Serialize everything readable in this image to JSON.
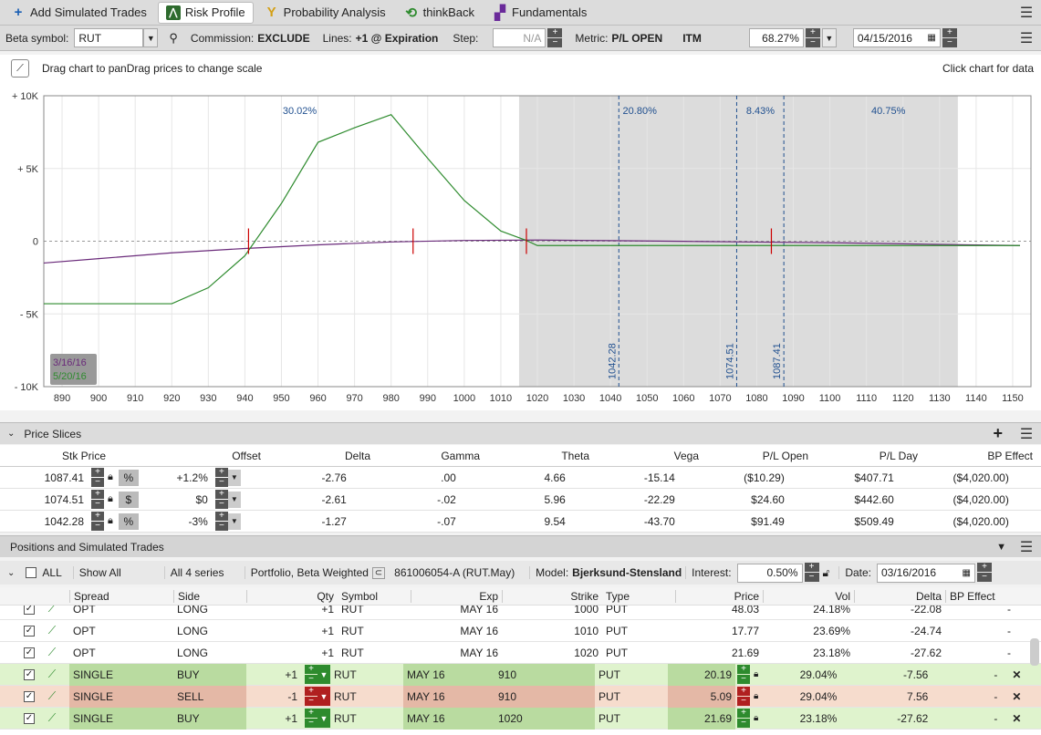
{
  "tabs": [
    {
      "label": "Add Simulated Trades",
      "icon": "plus-icon"
    },
    {
      "label": "Risk Profile",
      "icon": "risk-profile-icon"
    },
    {
      "label": "Probability Analysis",
      "icon": "probability-icon"
    },
    {
      "label": "thinkBack",
      "icon": "thinkback-icon"
    },
    {
      "label": "Fundamentals",
      "icon": "fundamentals-icon"
    }
  ],
  "toolbar": {
    "beta_label": "Beta symbol:",
    "beta_value": "RUT",
    "commission_label": "Commission:",
    "commission_value": "EXCLUDE",
    "lines_label": "Lines:",
    "lines_value": "+1 @ Expiration",
    "step_label": "Step:",
    "step_value": "N/A",
    "metric_label": "Metric:",
    "metric_value": "P/L OPEN",
    "itm": "ITM",
    "pct_value": "68.27%",
    "date_value": "04/15/2016"
  },
  "chart_header": {
    "hint": "Drag chart to panDrag prices to change scale",
    "click_hint": "Click chart for data"
  },
  "chart_data": {
    "type": "line",
    "x_ticks": [
      890,
      900,
      910,
      920,
      930,
      940,
      950,
      960,
      970,
      980,
      990,
      1000,
      1010,
      1020,
      1030,
      1040,
      1050,
      1060,
      1070,
      1080,
      1090,
      1100,
      1110,
      1120,
      1130,
      1140,
      1150
    ],
    "y_ticks": [
      "+ 10K",
      "+ 5K",
      "0",
      "- 5K",
      "- 10K"
    ],
    "y_tick_values": [
      10000,
      5000,
      0,
      -5000,
      -10000
    ],
    "xlim": [
      885,
      1155
    ],
    "ylim": [
      -10000,
      10000
    ],
    "prob_labels": [
      "30.02%",
      "20.80%",
      "8.43%",
      "40.75%"
    ],
    "prob_label_x": [
      955,
      1048,
      1081,
      1116
    ],
    "shaded_range": [
      1015,
      1135
    ],
    "vlines": [
      {
        "x": 1042.28,
        "label": "1042.28"
      },
      {
        "x": 1074.51,
        "label": "1074.51"
      },
      {
        "x": 1087.41,
        "label": "1087.41"
      }
    ],
    "markers": [
      941,
      986,
      1017,
      1084
    ],
    "legend": [
      "3/16/16",
      "5/20/16"
    ],
    "series": [
      {
        "name": "3/16/16",
        "color": "#6a2a7a",
        "x": [
          885,
          900,
          920,
          940,
          960,
          980,
          1000,
          1020,
          1040,
          1060,
          1080,
          1100,
          1120,
          1140,
          1152
        ],
        "y": [
          -1500,
          -1200,
          -800,
          -500,
          -250,
          -50,
          50,
          80,
          40,
          -10,
          -60,
          -100,
          -180,
          -260,
          -300
        ]
      },
      {
        "name": "5/20/16",
        "color": "#2e8b2e",
        "x": [
          885,
          920,
          930,
          940,
          950,
          960,
          970,
          980,
          990,
          1000,
          1010,
          1017,
          1020,
          1050,
          1100,
          1152
        ],
        "y": [
          -4300,
          -4300,
          -3200,
          -1000,
          2600,
          6800,
          7800,
          8700,
          5700,
          2800,
          700,
          50,
          -300,
          -300,
          -300,
          -300
        ]
      }
    ]
  },
  "price_slices": {
    "title": "Price Slices",
    "headers": [
      "Stk Price",
      "Offset",
      "Delta",
      "Gamma",
      "Theta",
      "Vega",
      "P/L Open",
      "P/L Day",
      "BP Effect"
    ],
    "rows": [
      {
        "price": "1087.41",
        "unit": "%",
        "offset": "+1.2%",
        "delta": "-2.76",
        "gamma": ".00",
        "theta": "4.66",
        "vega": "-15.14",
        "pl_open": "($10.29)",
        "pl_day": "$407.71",
        "bp": "($4,020.00)"
      },
      {
        "price": "1074.51",
        "unit": "$",
        "offset": "$0",
        "delta": "-2.61",
        "gamma": "-.02",
        "theta": "5.96",
        "vega": "-22.29",
        "pl_open": "$24.60",
        "pl_day": "$442.60",
        "bp": "($4,020.00)"
      },
      {
        "price": "1042.28",
        "unit": "%",
        "offset": "-3%",
        "delta": "-1.27",
        "gamma": "-.07",
        "theta": "9.54",
        "vega": "-43.70",
        "pl_open": "$91.49",
        "pl_day": "$509.49",
        "bp": "($4,020.00)"
      }
    ]
  },
  "positions": {
    "title": "Positions and Simulated Trades",
    "all": "ALL",
    "show": "Show All",
    "series": "All 4 series",
    "portfolio": "Portfolio, Beta Weighted",
    "account": "861006054-A (RUT.May)",
    "model_label": "Model:",
    "model": "Bjerksund-Stensland",
    "interest_label": "Interest:",
    "interest": "0.50%",
    "date_label": "Date:",
    "date": "03/16/2016",
    "headers": [
      "Spread",
      "Side",
      "Qty",
      "Symbol",
      "Exp",
      "Strike",
      "Type",
      "Price",
      "Vol",
      "Delta",
      "BP Effect"
    ],
    "rows": [
      {
        "kind": "opt",
        "spread": "OPT",
        "side": "LONG",
        "qty": "+1",
        "symbol": "RUT",
        "exp": "MAY 16",
        "strike": "1000",
        "type": "PUT",
        "price": "48.03",
        "vol": "24.18%",
        "delta": "-22.08",
        "bp": "-"
      },
      {
        "kind": "opt",
        "spread": "OPT",
        "side": "LONG",
        "qty": "+1",
        "symbol": "RUT",
        "exp": "MAY 16",
        "strike": "1010",
        "type": "PUT",
        "price": "17.77",
        "vol": "23.69%",
        "delta": "-24.74",
        "bp": "-"
      },
      {
        "kind": "opt",
        "spread": "OPT",
        "side": "LONG",
        "qty": "+1",
        "symbol": "RUT",
        "exp": "MAY 16",
        "strike": "1020",
        "type": "PUT",
        "price": "21.69",
        "vol": "23.18%",
        "delta": "-27.62",
        "bp": "-"
      },
      {
        "kind": "buy",
        "spread": "SINGLE",
        "side": "BUY",
        "qty": "+1",
        "symbol": "RUT",
        "exp": "MAY 16",
        "strike": "910",
        "type": "PUT",
        "price": "20.19",
        "vol": "29.04%",
        "delta": "-7.56",
        "bp": "-"
      },
      {
        "kind": "sell",
        "spread": "SINGLE",
        "side": "SELL",
        "qty": "-1",
        "symbol": "RUT",
        "exp": "MAY 16",
        "strike": "910",
        "type": "PUT",
        "price": "5.09",
        "vol": "29.04%",
        "delta": "7.56",
        "bp": "-"
      },
      {
        "kind": "buy",
        "spread": "SINGLE",
        "side": "BUY",
        "qty": "+1",
        "symbol": "RUT",
        "exp": "MAY 16",
        "strike": "1020",
        "type": "PUT",
        "price": "21.69",
        "vol": "23.18%",
        "delta": "-27.62",
        "bp": "-"
      }
    ]
  }
}
